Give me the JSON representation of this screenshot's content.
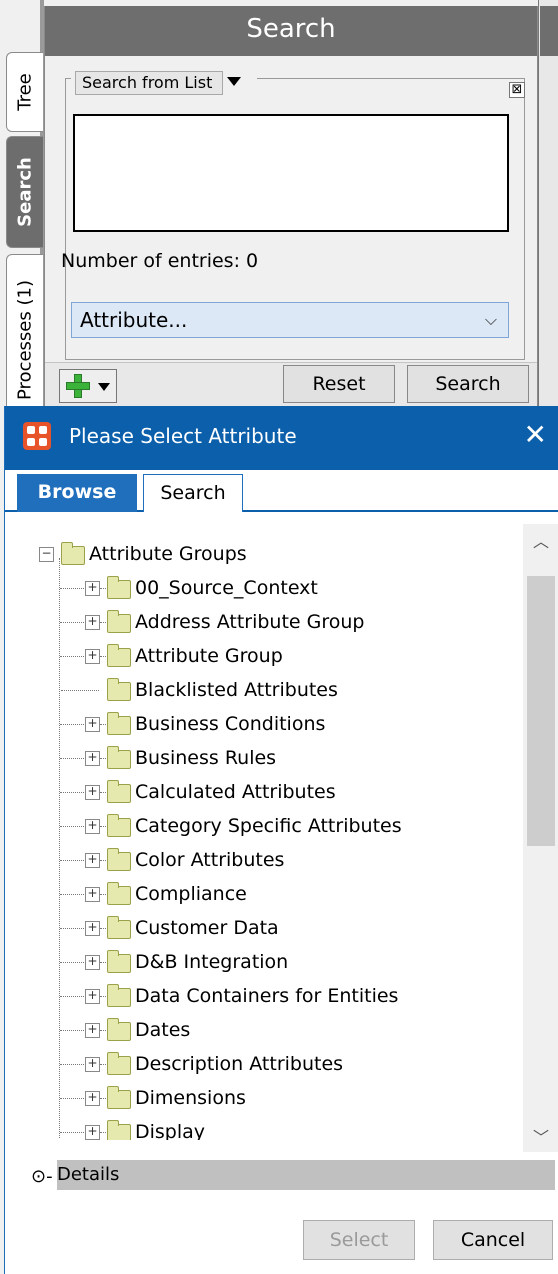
{
  "side_tabs": [
    {
      "label": "Tree",
      "active": false
    },
    {
      "label": "Search",
      "active": true
    },
    {
      "label": "Processes (1)",
      "active": false
    }
  ],
  "search_panel": {
    "title": "Search",
    "list_mode": "Search from List",
    "close_glyph": "⊠",
    "entries_text": "Number of entries: 0",
    "attribute_value": "Attribute...",
    "reset_label": "Reset",
    "search_label": "Search"
  },
  "dialog": {
    "title": "Please Select Attribute",
    "close_glyph": "✕",
    "tabs": [
      "Browse",
      "Search"
    ],
    "tree_root": "Attribute Groups",
    "tree_items": [
      {
        "label": "00_Source_Context",
        "expandable": true
      },
      {
        "label": "Address Attribute Group",
        "expandable": true
      },
      {
        "label": "Attribute Group",
        "expandable": true
      },
      {
        "label": "Blacklisted Attributes",
        "expandable": false
      },
      {
        "label": "Business Conditions",
        "expandable": true
      },
      {
        "label": "Business Rules",
        "expandable": true
      },
      {
        "label": "Calculated Attributes",
        "expandable": true
      },
      {
        "label": "Category Specific Attributes",
        "expandable": true
      },
      {
        "label": "Color Attributes",
        "expandable": true
      },
      {
        "label": "Compliance",
        "expandable": true
      },
      {
        "label": "Customer Data",
        "expandable": true
      },
      {
        "label": "D&B Integration",
        "expandable": true
      },
      {
        "label": "Data Containers for Entities",
        "expandable": true
      },
      {
        "label": "Dates",
        "expandable": true
      },
      {
        "label": "Description Attributes",
        "expandable": true
      },
      {
        "label": "Dimensions",
        "expandable": true
      },
      {
        "label": "Display",
        "expandable": true
      }
    ],
    "details_label": "Details",
    "select_label": "Select",
    "cancel_label": "Cancel"
  },
  "colors": {
    "dialog_title_bg": "#0b5fab",
    "panel_header_bg": "#6e6e6e",
    "folder_fill": "#e6e9ad"
  }
}
